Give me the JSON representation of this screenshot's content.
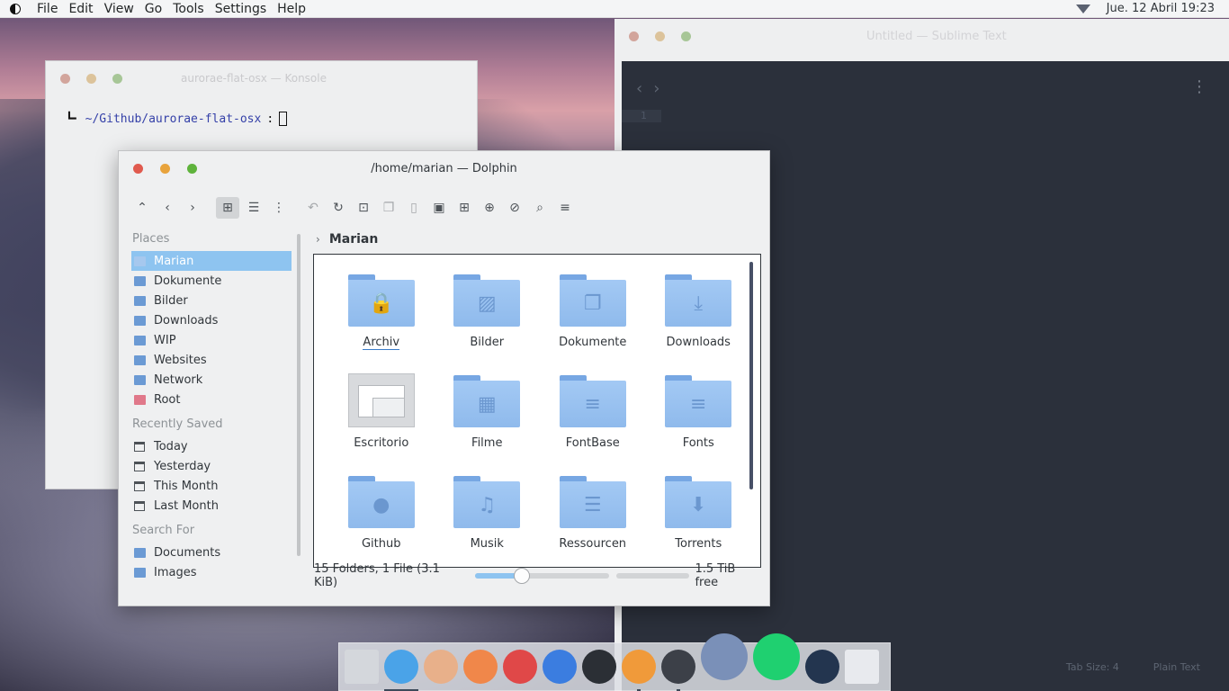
{
  "menubar": {
    "items": [
      "File",
      "Edit",
      "View",
      "Go",
      "Tools",
      "Settings",
      "Help"
    ],
    "datetime": "Jue. 12 Abril 19:23"
  },
  "terminal": {
    "title": "aurorae-flat-osx — Konsole",
    "prompt_corner": "┗╸",
    "prompt_path": "~/Github/aurorae-flat-osx",
    "prompt_colon": ":"
  },
  "editor": {
    "title": "Untitled — Sublime Text",
    "line_number": "1",
    "tab_size": "Tab Size: 4",
    "syntax": "Plain Text"
  },
  "dolphin": {
    "title": "/home/marian — Dolphin",
    "places_header": "Places",
    "places": [
      {
        "label": "Marian",
        "icon": "home-folder-icon"
      },
      {
        "label": "Dokumente",
        "icon": "folder-icon"
      },
      {
        "label": "Bilder",
        "icon": "folder-icon"
      },
      {
        "label": "Downloads",
        "icon": "folder-icon"
      },
      {
        "label": "WIP",
        "icon": "folder-icon"
      },
      {
        "label": "Websites",
        "icon": "folder-icon"
      },
      {
        "label": "Network",
        "icon": "network-folder-icon"
      },
      {
        "label": "Root",
        "icon": "root-folder-icon"
      }
    ],
    "recent_header": "Recently Saved",
    "recent": [
      "Today",
      "Yesterday",
      "This Month",
      "Last Month"
    ],
    "search_header": "Search For",
    "search": [
      "Documents",
      "Images"
    ],
    "breadcrumb": "Marian",
    "files": [
      {
        "name": "Archiv",
        "glyph": "🔒"
      },
      {
        "name": "Bilder",
        "glyph": "▨"
      },
      {
        "name": "Dokumente",
        "glyph": "❐"
      },
      {
        "name": "Downloads",
        "glyph": "⤓"
      },
      {
        "name": "Escritorio",
        "glyph": ""
      },
      {
        "name": "Filme",
        "glyph": "▦"
      },
      {
        "name": "FontBase",
        "glyph": "≡"
      },
      {
        "name": "Fonts",
        "glyph": "≡"
      },
      {
        "name": "Github",
        "glyph": "●"
      },
      {
        "name": "Musik",
        "glyph": "♫"
      },
      {
        "name": "Ressourcen",
        "glyph": "☰"
      },
      {
        "name": "Torrents",
        "glyph": "⬇"
      }
    ],
    "status_text": "15 Folders, 1 File (3.1 KiB)",
    "zoom_level": 0.33,
    "free_space": "1.5 TiB free"
  },
  "dock": {
    "apps": [
      {
        "name": "desktop-app",
        "color": "#d4d7dc"
      },
      {
        "name": "finder-app",
        "color": "#4aa3e8"
      },
      {
        "name": "contacts-app",
        "color": "#e8b08a"
      },
      {
        "name": "firefox-app",
        "color": "#f0874a"
      },
      {
        "name": "vivaldi-app",
        "color": "#e04848"
      },
      {
        "name": "chromium-app",
        "color": "#3b7de0"
      },
      {
        "name": "terminal-app",
        "color": "#2b2f35"
      },
      {
        "name": "sublime-app",
        "color": "#f09a3a"
      },
      {
        "name": "inkscape-app",
        "color": "#3c4048"
      },
      {
        "name": "mascot-app",
        "color": "#7a90b8"
      },
      {
        "name": "spotify-app",
        "color": "#1fd070"
      },
      {
        "name": "downloader-app",
        "color": "#23354f"
      },
      {
        "name": "trash-app",
        "color": "#e8eaee"
      }
    ]
  }
}
